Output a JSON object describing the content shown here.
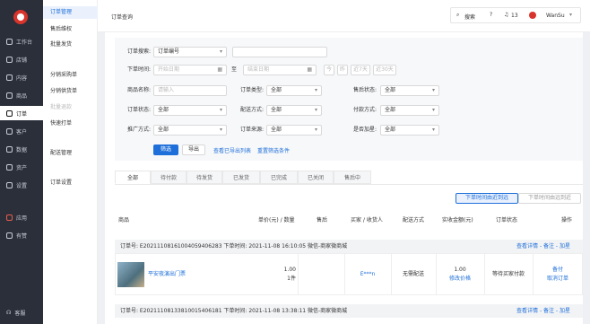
{
  "sidebar": {
    "items": [
      {
        "label": "工作台",
        "icon": "dashboard-icon"
      },
      {
        "label": "店铺",
        "icon": "store-icon"
      },
      {
        "label": "内容",
        "icon": "content-icon"
      },
      {
        "label": "商品",
        "icon": "goods-icon"
      },
      {
        "label": "订单",
        "icon": "order-icon"
      },
      {
        "label": "客户",
        "icon": "customer-icon"
      },
      {
        "label": "数据",
        "icon": "data-icon"
      },
      {
        "label": "资产",
        "icon": "assets-icon"
      },
      {
        "label": "设置",
        "icon": "settings-icon"
      },
      {
        "label": "应用",
        "icon": "apps-icon"
      },
      {
        "label": "有赞",
        "icon": "youzan-icon"
      }
    ],
    "bottom": "客服"
  },
  "subnav": {
    "items": [
      "订单管理",
      "售后维权",
      "批量发货",
      "分销采购单",
      "分销供货单",
      "批量退款",
      "快速打单",
      "配送管理",
      "订单设置"
    ]
  },
  "header": {
    "title": "订单查询",
    "search": "搜索",
    "notif_count": "13",
    "user": "WanSu"
  },
  "filters": {
    "search_label": "订单搜索:",
    "search_type": "订单编号",
    "time_label": "下单时间:",
    "start_ph": "开始日期",
    "to": "至",
    "end_ph": "结束日期",
    "quick": [
      "今",
      "昨",
      "近7天",
      "近30天"
    ],
    "name_label": "商品名称:",
    "name_ph": "请输入",
    "type_label": "订单类型:",
    "type_val": "全部",
    "after_label": "售后状态:",
    "after_val": "全部",
    "status_label": "订单状态:",
    "status_val": "全部",
    "ship_label": "配送方式:",
    "ship_val": "全部",
    "pay_label": "付款方式:",
    "pay_val": "全部",
    "promo_label": "推广方式:",
    "promo_val": "全部",
    "src_label": "订单来源:",
    "src_val": "全部",
    "plus_label": "是否加星:",
    "plus_val": "全部",
    "filter_btn": "筛选",
    "export_btn": "导出",
    "link_export": "查看已导出列表",
    "link_reset": "重置筛选条件"
  },
  "tabs": [
    "全部",
    "待付款",
    "待发货",
    "已发货",
    "已完成",
    "已关闭",
    "售后中"
  ],
  "sort": {
    "near": "下单时间由近到远",
    "far": "下单时间由远到近"
  },
  "table": {
    "headers": [
      "商品",
      "单价(元) / 数量",
      "售后",
      "买家 / 收货人",
      "配送方式",
      "实收金额(元)",
      "订单状态",
      "操作"
    ]
  },
  "orders": [
    {
      "meta": "订单号: E20211108161004059406283   下单时间: 2021-11-08 16:10:05   微信-商家微商城",
      "actions": "查看详情 - 备注 - 加星",
      "product": "平安夜演出门票",
      "price": "1.00",
      "qty": "1件",
      "buyer": "E***n",
      "ship": "无需配送",
      "amount": "1.00",
      "amount_sub": "修改价格",
      "status": "等待买家付款",
      "op1": "备付",
      "op2": "取消订单"
    },
    {
      "meta": "订单号: E20211108133810015406181   下单时间: 2021-11-08 13:38:11   微信-商家微商城",
      "actions": "查看详情 - 备注 - 加星"
    }
  ]
}
